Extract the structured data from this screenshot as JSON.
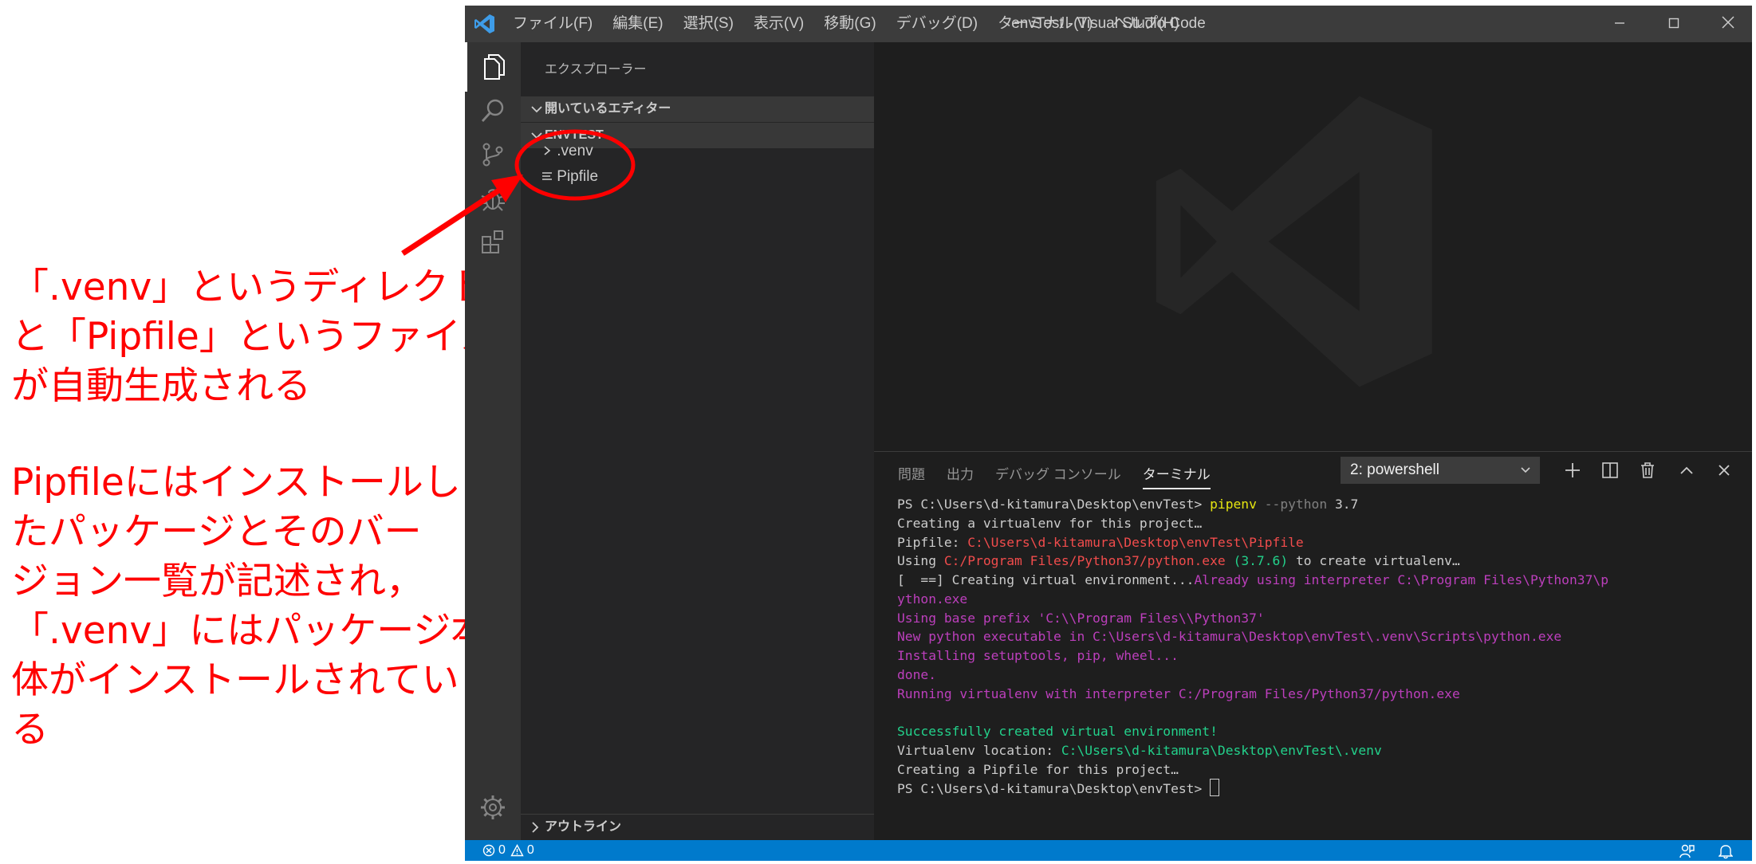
{
  "annotation": {
    "paragraph1": [
      "「.venv」というディレクトリ",
      "と「Pipfile」というファイル",
      "が自動生成される"
    ],
    "paragraph2": [
      "Pipfileにはインストールし",
      "たパッケージとそのバー",
      "ジョン一覧が記述され，",
      "「.venv」にはパッケージ本",
      "体がインストールされてい",
      "る"
    ]
  },
  "window": {
    "title": "envTest - Visual Studio Code",
    "menu": [
      "ファイル(F)",
      "編集(E)",
      "選択(S)",
      "表示(V)",
      "移動(G)",
      "デバッグ(D)",
      "ターミナル(T)",
      "ヘルプ(H)"
    ]
  },
  "activity_icons": [
    "files-icon",
    "search-icon",
    "source-control-icon",
    "debug-icon",
    "extensions-icon",
    "gear-icon"
  ],
  "sidebar": {
    "header": "エクスプローラー",
    "open_editors": "開いているエディター",
    "folder": "ENVTEST",
    "items": [
      ".venv",
      "Pipfile"
    ],
    "outline": "アウトライン"
  },
  "panel": {
    "tabs": [
      "問題",
      "出力",
      "デバッグ コンソール",
      "ターミナル"
    ],
    "active_tab": "ターミナル",
    "shell": "2: powershell",
    "terminal": {
      "l1_prompt": "PS C:\\Users\\d-kitamura\\Desktop\\envTest> ",
      "l1_cmd": "pipenv",
      "l1_arg": " --python ",
      "l1_ver": "3.7",
      "l2": "Creating a virtualenv for this project…",
      "l3_label": "Pipfile: ",
      "l3_path": "C:\\Users\\d-kitamura\\Desktop\\envTest\\Pipfile",
      "l4_a": "Using ",
      "l4_path": "C:/Program Files/Python37/python.exe",
      "l4_ver": " (3.7.6)",
      "l4_b": " to create virtualenv…",
      "l5_a": "[  ==] Creating virtual environment...",
      "l5_b": "Already using interpreter C:\\Program Files\\Python37\\p",
      "l6": "ython.exe",
      "l7": "Using base prefix 'C:\\\\Program Files\\\\Python37'",
      "l8": "New python executable in C:\\Users\\d-kitamura\\Desktop\\envTest\\.venv\\Scripts\\python.exe",
      "l9": "Installing setuptools, pip, wheel...",
      "l10": "done.",
      "l11": "Running virtualenv with interpreter C:/Program Files/Python37/python.exe",
      "l13": "Successfully created virtual environment!",
      "l14_label": "Virtualenv location: ",
      "l14_path": "C:\\Users\\d-kitamura\\Desktop\\envTest\\.venv",
      "l15": "Creating a Pipfile for this project…",
      "l16_prompt": "PS C:\\Users\\d-kitamura\\Desktop\\envTest> "
    }
  },
  "status": {
    "errors": "0",
    "warnings": "0"
  },
  "colors": {
    "annotation": "#ff0000",
    "statusbar": "#007acc",
    "titlebar": "#3c3c3c",
    "sidebar": "#252526",
    "editor": "#1e1e1e"
  }
}
